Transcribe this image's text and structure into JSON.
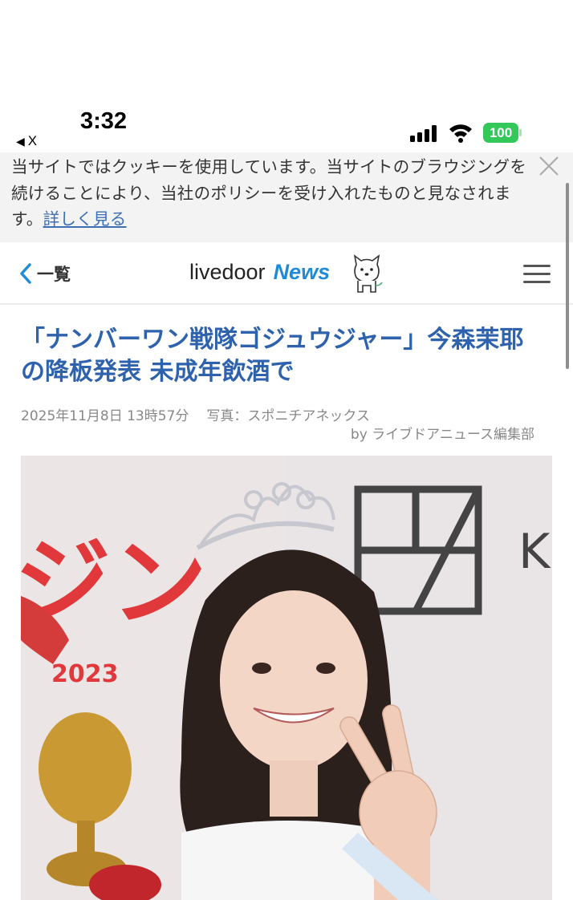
{
  "status": {
    "time": "3:32",
    "back_app": "X",
    "battery": "100"
  },
  "cookie_banner": {
    "text": "当サイトではクッキーを使用しています。当サイトのブラウジングを続けることにより、当社のポリシーを受け入れたものと見なされます。",
    "link": "詳しく見る"
  },
  "nav": {
    "back_label": "一覧",
    "logo_part1": "livedoor",
    "logo_part2": "News"
  },
  "article": {
    "headline": "「ナンバーワン戦隊ゴジュウジャー」今森茉耶の降板発表 未成年飲酒で",
    "date": "2025年11月8日 13時57分",
    "photo_credit": "写真：スポニチアネックス",
    "byline": "by ライブドアニュース編集部"
  },
  "photo": {
    "backdrop_text_left": "ジン",
    "backdrop_year": "2023"
  },
  "colors": {
    "headline": "#2f62ad",
    "logo_news": "#1f8bd8",
    "battery": "#34c759",
    "link": "#3f6fb3"
  }
}
